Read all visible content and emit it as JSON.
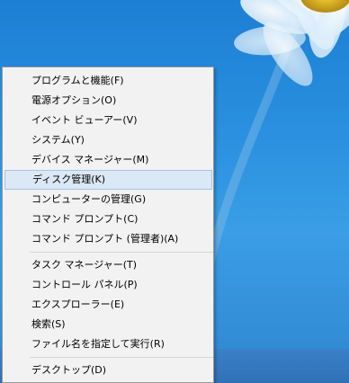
{
  "context_menu": {
    "items": [
      {
        "label": "プログラムと機能(F)"
      },
      {
        "label": "電源オプション(O)"
      },
      {
        "label": "イベント ビューアー(V)"
      },
      {
        "label": "システム(Y)"
      },
      {
        "label": "デバイス マネージャー(M)"
      },
      {
        "label": "ディスク管理(K)",
        "selected": true
      },
      {
        "label": "コンピューターの管理(G)"
      },
      {
        "label": "コマンド プロンプト(C)"
      },
      {
        "label": "コマンド プロンプト (管理者)(A)"
      },
      {
        "label": "タスク マネージャー(T)"
      },
      {
        "label": "コントロール パネル(P)"
      },
      {
        "label": "エクスプローラー(E)"
      },
      {
        "label": "検索(S)"
      },
      {
        "label": "ファイル名を指定して実行(R)"
      },
      {
        "label": "デスクトップ(D)"
      }
    ]
  },
  "colors": {
    "desktop_background": "#2a90df",
    "menu_background": "#f2f2f2",
    "selection_fill": "#dbe8f6",
    "selection_border": "#a6c3e6"
  }
}
